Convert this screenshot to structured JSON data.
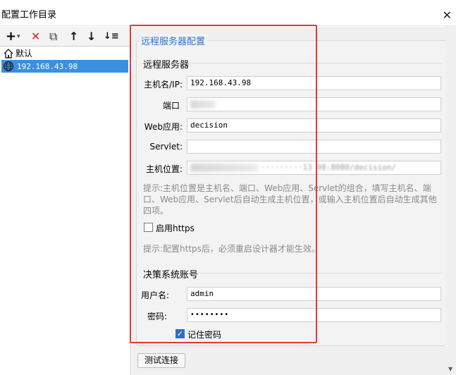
{
  "window": {
    "title": "配置工作目录",
    "close_glyph": "✕"
  },
  "toolbar": {
    "add": "+",
    "add_dropdown": "▾",
    "delete": "✕",
    "copy": "⧉",
    "move_up": "↑",
    "move_down": "↓",
    "sort": "↓≡"
  },
  "tree": {
    "items": [
      {
        "label": "默认",
        "icon": "home-icon"
      },
      {
        "label": "192.168.43.98",
        "icon": "globe-icon",
        "selected": true
      }
    ]
  },
  "form": {
    "title": "远程服务器配置",
    "server_section": "远程服务器",
    "host_label": "主机名/IP:",
    "host_value": "192.168.43.98",
    "port_label": "端口",
    "webapp_label": "Web应用:",
    "webapp_value": "decision",
    "servlet_label": "Servlet:",
    "servlet_value": "",
    "location_label": "主机位置:",
    "location_visible_fragment": "·········13 98:8080/decision/",
    "hint_text": "提示:主机位置是主机名、端口、Web应用、Servlet的组合，填写主机名、端口、Web应用、Servlet后自动生成主机位置，或输入主机位置后自动生成其他四项。",
    "https_label": "启用https",
    "https_checked": false,
    "https_hint": "提示:配置https后，必须重启设计器才能生效。",
    "account_section": "决策系统账号",
    "username_label": "用户名:",
    "username_value": "admin",
    "password_label": "密码:",
    "password_value": "••••••••",
    "remember_label": "记住密码",
    "remember_checked": true
  },
  "buttons": {
    "test_connection": "测试连接"
  },
  "colors": {
    "accent": "#2a76c6",
    "selection": "#3c8fe0",
    "annotation": "#e53935"
  }
}
